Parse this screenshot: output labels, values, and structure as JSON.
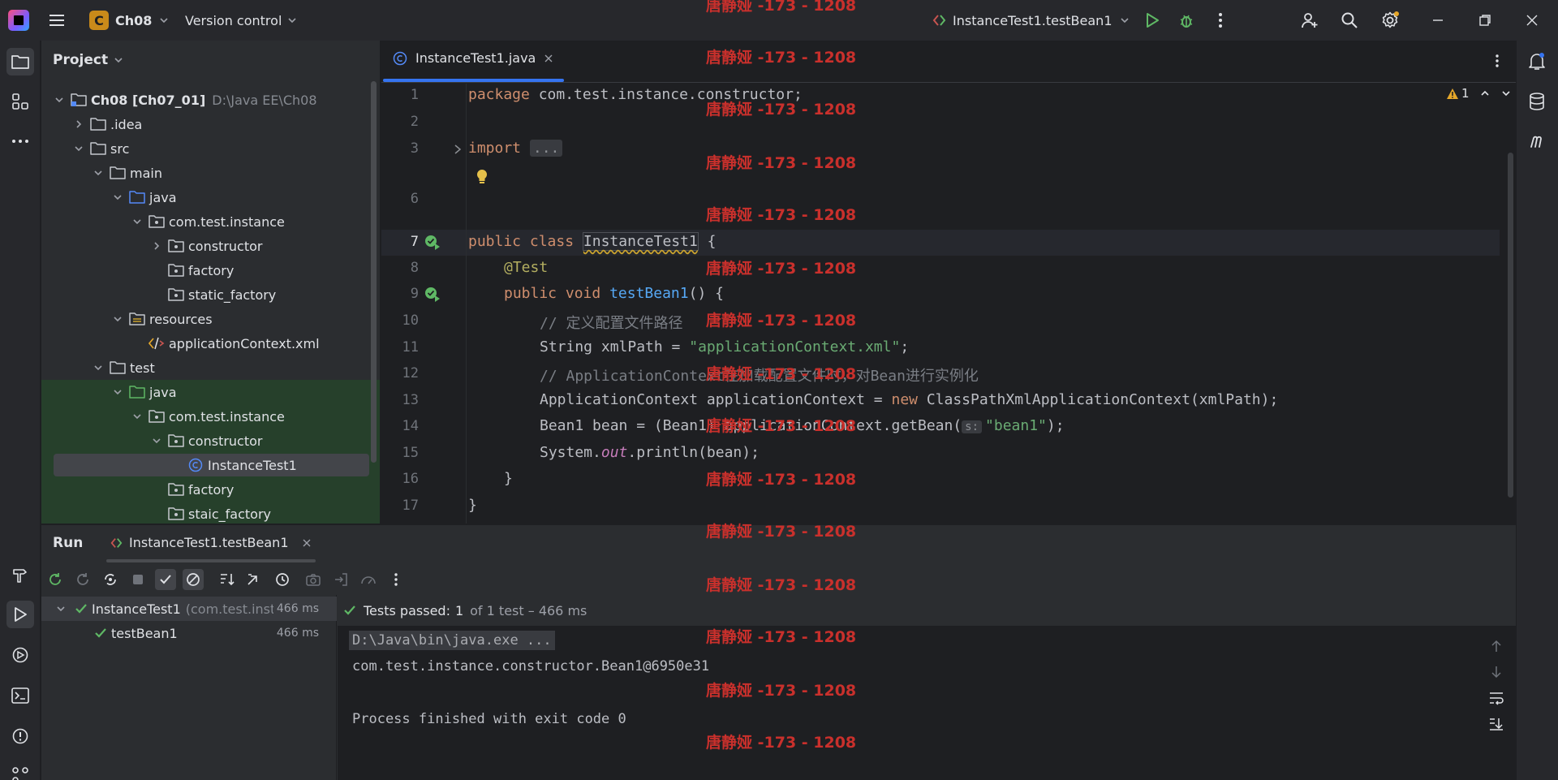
{
  "titlebar": {
    "project_badge": "C",
    "project_name": "Ch08",
    "vcs_label": "Version control",
    "run_config": "InstanceTest1.testBean1"
  },
  "project_panel": {
    "title": "Project",
    "tree": [
      {
        "label": "Ch08 [Ch07_01]",
        "muted": "D:\\Java EE\\Ch08",
        "depth": 0,
        "chevron": "down",
        "icon": "module-folder-icon",
        "scope": ""
      },
      {
        "label": ".idea",
        "depth": 1,
        "chevron": "right",
        "icon": "folder-icon",
        "scope": ""
      },
      {
        "label": "src",
        "depth": 1,
        "chevron": "down",
        "icon": "folder-icon",
        "scope": ""
      },
      {
        "label": "main",
        "depth": 2,
        "chevron": "down",
        "icon": "folder-icon",
        "scope": ""
      },
      {
        "label": "java",
        "depth": 3,
        "chevron": "down",
        "icon": "source-folder-icon",
        "scope": ""
      },
      {
        "label": "com.test.instance",
        "depth": 4,
        "chevron": "down",
        "icon": "package-icon",
        "scope": ""
      },
      {
        "label": "constructor",
        "depth": 5,
        "chevron": "right",
        "icon": "package-icon",
        "scope": ""
      },
      {
        "label": "factory",
        "depth": 5,
        "chevron": "",
        "icon": "package-icon",
        "scope": ""
      },
      {
        "label": "static_factory",
        "depth": 5,
        "chevron": "",
        "icon": "package-icon",
        "scope": ""
      },
      {
        "label": "resources",
        "depth": 3,
        "chevron": "down",
        "icon": "resources-folder-icon",
        "scope": ""
      },
      {
        "label": "applicationContext.xml",
        "depth": 4,
        "chevron": "",
        "icon": "xml-file-icon",
        "scope": ""
      },
      {
        "label": "test",
        "depth": 2,
        "chevron": "down",
        "icon": "folder-icon",
        "scope": ""
      },
      {
        "label": "java",
        "depth": 3,
        "chevron": "down",
        "icon": "test-source-folder-icon",
        "scope": "test"
      },
      {
        "label": "com.test.instance",
        "depth": 4,
        "chevron": "down",
        "icon": "package-icon",
        "scope": "test"
      },
      {
        "label": "constructor",
        "depth": 5,
        "chevron": "down",
        "icon": "package-icon",
        "scope": "test"
      },
      {
        "label": "InstanceTest1",
        "depth": 6,
        "chevron": "",
        "icon": "class-icon",
        "scope": "test",
        "selected": true
      },
      {
        "label": "factory",
        "depth": 5,
        "chevron": "",
        "icon": "package-icon",
        "scope": "test"
      },
      {
        "label": "staic_factory",
        "depth": 5,
        "chevron": "",
        "icon": "package-icon",
        "scope": "test"
      }
    ]
  },
  "editor": {
    "tab_label": "InstanceTest1.java",
    "warning_count": "1",
    "line_numbers": [
      "1",
      "2",
      "3",
      "6",
      "7",
      "8",
      "9",
      "10",
      "11",
      "12",
      "13",
      "14",
      "15",
      "16",
      "17"
    ],
    "lines": {
      "l1_kw": "package",
      "l1_rest": " com.test.instance.constructor;",
      "l3_kw": "import",
      "l3_fold": "...",
      "l7_kw1": "public",
      "l7_kw2": "class",
      "l7_cls": "InstanceTest1",
      "l7_brace": " {",
      "l8_ann": "@Test",
      "l9_kw1": "public",
      "l9_kw2": "void",
      "l9_fn": "testBean1",
      "l9_rest": "() {",
      "l10_cm": "// 定义配置文件路径",
      "l11_pre": "String xmlPath = ",
      "l11_str": "\"applicationContext.xml\"",
      "l11_post": ";",
      "l12_cm": "// ApplicationContext在加载配置文件时，对Bean进行实例化",
      "l13_pre": "ApplicationContext applicationContext = ",
      "l13_kw": "new",
      "l13_post": " ClassPathXmlApplicationContext(xmlPath);",
      "l14_pre": "Bean1 bean = (Bean1) applicationContext.getBean(",
      "l14_hint": "s:",
      "l14_str": "\"bean1\"",
      "l14_post": ");",
      "l15_pre": "System.",
      "l15_it": "out",
      "l15_post": ".println(bean);",
      "l16": "}",
      "l17": "}"
    }
  },
  "watermark": "唐静娅 -173 - 1208",
  "run_panel": {
    "title": "Run",
    "tab_label": "InstanceTest1.testBean1",
    "tests": [
      {
        "name": "InstanceTest1",
        "detail": "(com.test.insta",
        "time": "466 ms"
      },
      {
        "name": "testBean1",
        "detail": "",
        "time": "466 ms"
      }
    ],
    "status_prefix": "Tests passed:",
    "status_count": "1",
    "status_suffix": "of 1 test – 466 ms",
    "console": [
      "D:\\Java\\bin\\java.exe ...",
      "com.test.instance.constructor.Bean1@6950e31",
      "",
      "Process finished with exit code 0"
    ]
  },
  "colors": {
    "accent": "#3574f0",
    "success": "#5fb865",
    "watermark": "#c9302c"
  }
}
